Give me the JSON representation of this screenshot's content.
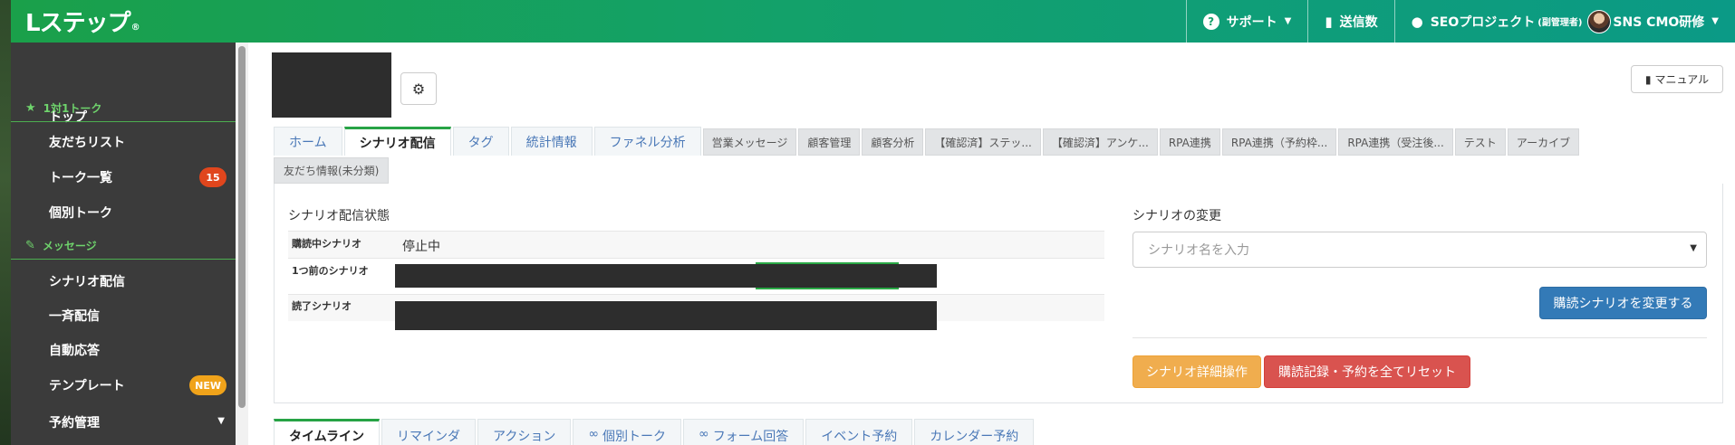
{
  "header": {
    "logo_main": "Lステップ",
    "logo_mark": "®",
    "support_label": "サポート",
    "send_count_label": "送信数",
    "project_label": "SEOプロジェクト",
    "project_role": "(副管理者)",
    "account_label": "SNS CMO研修"
  },
  "sidebar": {
    "items": [
      {
        "label": "トップ"
      },
      {
        "section": "1対1トーク"
      },
      {
        "label": "友だちリスト"
      },
      {
        "label": "トーク一覧",
        "badge": "15"
      },
      {
        "label": "個別トーク"
      },
      {
        "section": "メッセージ"
      },
      {
        "label": "シナリオ配信"
      },
      {
        "label": "一斉配信"
      },
      {
        "label": "自動応答"
      },
      {
        "label": "テンプレート",
        "badge": "NEW"
      },
      {
        "label": "予約管理"
      }
    ]
  },
  "manual_label": "マニュアル",
  "tabs": [
    {
      "label": "ホーム"
    },
    {
      "label": "シナリオ配信"
    },
    {
      "label": "タグ"
    },
    {
      "label": "統計情報"
    },
    {
      "label": "ファネル分析"
    },
    {
      "label": "営業メッセージ"
    },
    {
      "label": "顧客管理"
    },
    {
      "label": "顧客分析"
    },
    {
      "label": "【確認済】ステッ..."
    },
    {
      "label": "【確認済】アンケ..."
    },
    {
      "label": "RPA連携"
    },
    {
      "label": "RPA連携（予約枠..."
    },
    {
      "label": "RPA連携（受注後..."
    },
    {
      "label": "テスト"
    },
    {
      "label": "アーカイブ"
    },
    {
      "label": "友だち情報(未分類)"
    }
  ],
  "scenario_status": {
    "title": "シナリオ配信状態",
    "current_label": "購読中シナリオ",
    "current_value": "停止中",
    "previous_label": "1つ前のシナリオ",
    "finished_label": "読了シナリオ"
  },
  "scenario_change": {
    "title": "シナリオの変更",
    "placeholder": "シナリオ名を入力",
    "change_button": "購読シナリオを変更する",
    "detail_button": "シナリオ詳細操作",
    "reset_button": "購読記録・予約を全てリセット"
  },
  "bottom_tabs": [
    {
      "label": "タイムライン"
    },
    {
      "label": "リマインダ"
    },
    {
      "label": "アクション"
    },
    {
      "label": "個別トーク"
    },
    {
      "label": "フォーム回答"
    },
    {
      "label": "イベント予約"
    },
    {
      "label": "カレンダー予約"
    }
  ]
}
